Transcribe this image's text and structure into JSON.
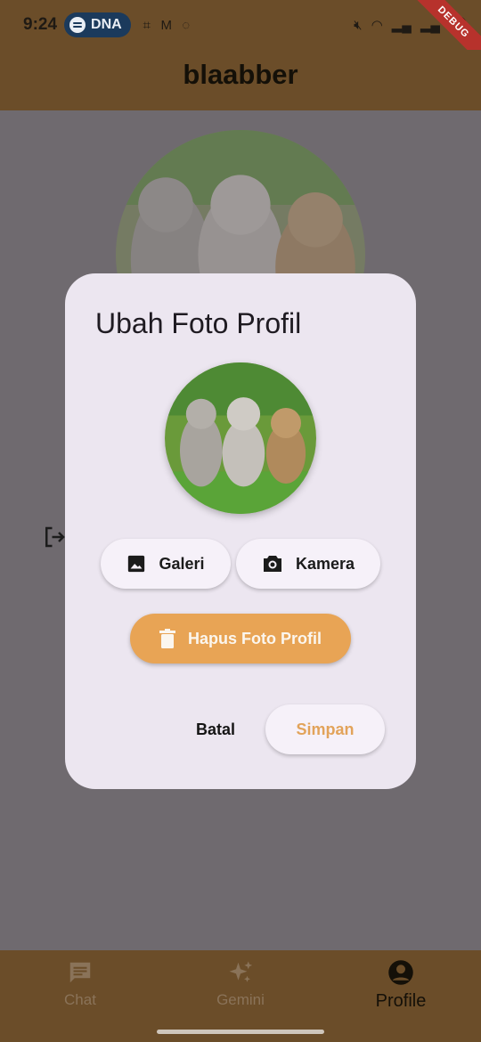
{
  "status_bar": {
    "time": "9:24",
    "spotify_label": "DNA",
    "debug_banner": "DEBUG"
  },
  "app_bar": {
    "title": "blaabber"
  },
  "dialog": {
    "title": "Ubah Foto Profil",
    "galeri_label": "Galeri",
    "kamera_label": "Kamera",
    "hapus_label": "Hapus Foto Profil",
    "batal_label": "Batal",
    "simpan_label": "Simpan"
  },
  "bottom_nav": {
    "items": [
      {
        "label": "Chat",
        "icon": "chat-icon",
        "active": false
      },
      {
        "label": "Gemini",
        "icon": "sparkle-icon",
        "active": false
      },
      {
        "label": "Profile",
        "icon": "account-circle-icon",
        "active": true
      }
    ]
  },
  "colors": {
    "brand_brown": "#6b4d29",
    "accent_orange": "#e8a455",
    "dialog_bg": "#ece6f0",
    "scrim": "#6f6a6f"
  }
}
